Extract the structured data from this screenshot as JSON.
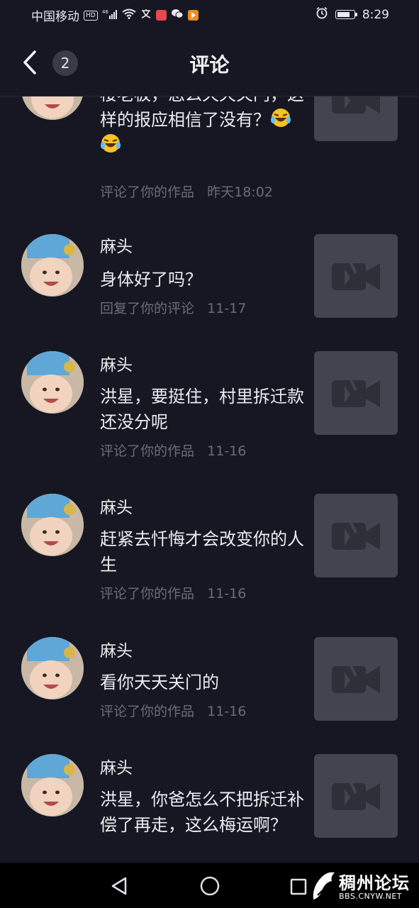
{
  "status_bar": {
    "carrier": "中国移动",
    "hd": "HD",
    "network": "46",
    "time": "8:29"
  },
  "header": {
    "back_icon": "chevron-left-icon",
    "badge_count": "2",
    "title": "评论"
  },
  "comments": [
    {
      "name": "",
      "text": "楼老板，怎么天天关门，这样的报应相信了没有？",
      "emoji": "rofl-emoji",
      "action": "评论了你的作品",
      "time": "昨天18:02"
    },
    {
      "name": "麻头",
      "text": "身体好了吗？",
      "action": "回复了你的评论",
      "time": "11-17"
    },
    {
      "name": "麻头",
      "text": "洪星，要挺住，村里拆迁款还没分呢",
      "action": "评论了你的作品",
      "time": "11-16"
    },
    {
      "name": "麻头",
      "text": "赶紧去忏悔才会改变你的人生",
      "action": "评论了你的作品",
      "time": "11-16"
    },
    {
      "name": "麻头",
      "text": "看你天天关门的",
      "action": "评论了你的作品",
      "time": "11-16"
    },
    {
      "name": "麻头",
      "text": "洪星，你爸怎么不把拆迁补偿了再走，这么梅运啊？",
      "action": "",
      "time": ""
    }
  ],
  "watermark": {
    "title": "稠州论坛",
    "url": "BBS.CNYW.NET"
  },
  "colors": {
    "background": "#161722",
    "thumbnail": "#43444f",
    "meta_text": "#6b6c78"
  }
}
